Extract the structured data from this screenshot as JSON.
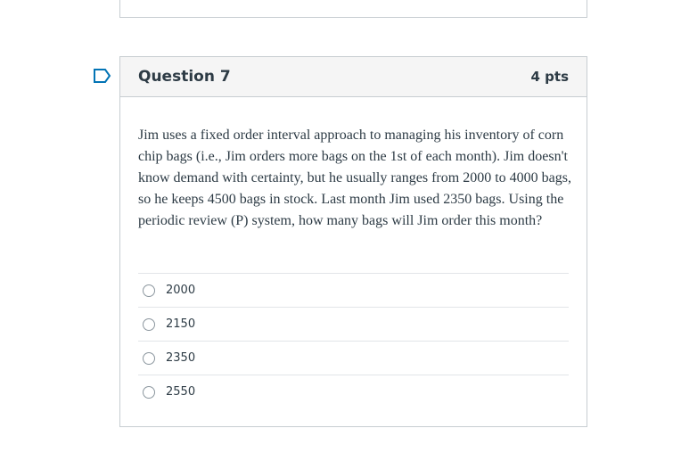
{
  "question": {
    "title": "Question 7",
    "points": "4 pts",
    "text": "Jim uses a fixed order interval approach to managing his inventory of corn chip bags (i.e., Jim orders more bags on the 1st of each month). Jim doesn't know demand with certainty, but he usually ranges from 2000 to 4000 bags, so he keeps 4500 bags in stock. Last month Jim used 2350 bags. Using the periodic review (P) system, how many bags will Jim order this month?",
    "flag_icon": "flag-outline-icon",
    "answers": [
      {
        "label": "2000"
      },
      {
        "label": "2150"
      },
      {
        "label": "2350"
      },
      {
        "label": "2550"
      }
    ]
  },
  "colors": {
    "text": "#2d3b45",
    "border": "#c7cdd1",
    "header_bg": "#f5f5f5",
    "flag": "#0374b5"
  }
}
